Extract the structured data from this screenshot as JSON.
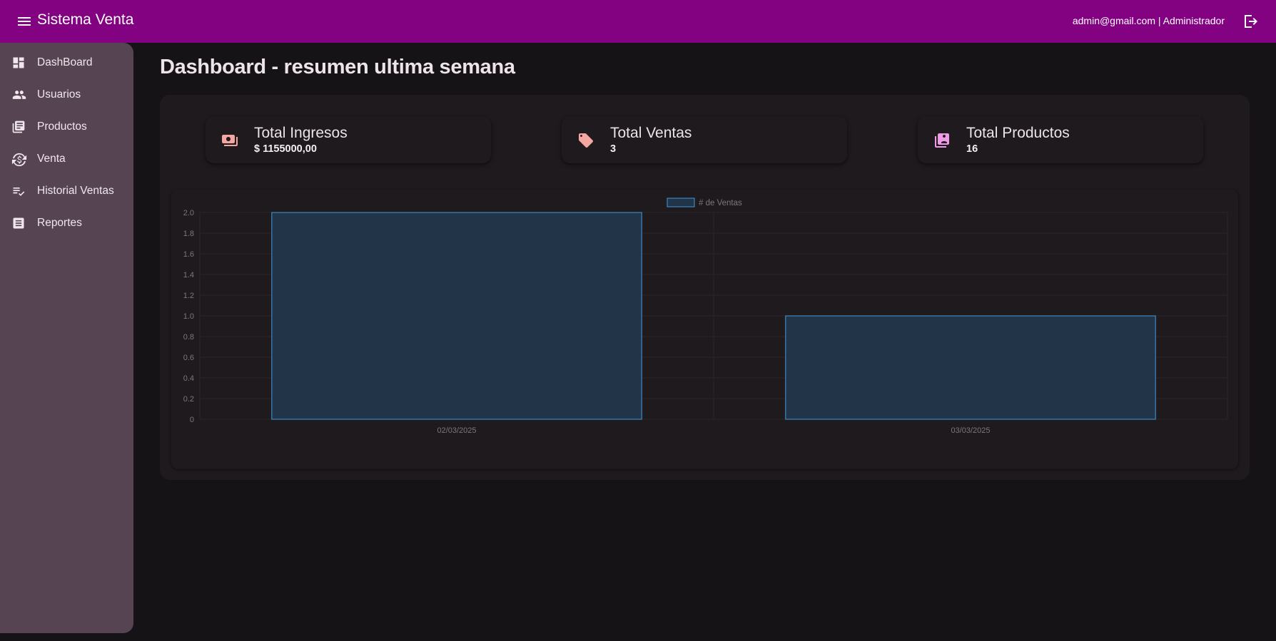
{
  "header": {
    "app_title": "Sistema Venta",
    "user_info": "admin@gmail.com | Administrador",
    "menu_icon": "menu-icon",
    "logout_icon": "logout-icon"
  },
  "sidebar": {
    "items": [
      {
        "label": "DashBoard",
        "icon": "dashboard-icon"
      },
      {
        "label": "Usuarios",
        "icon": "users-icon"
      },
      {
        "label": "Productos",
        "icon": "products-icon"
      },
      {
        "label": "Venta",
        "icon": "sale-icon"
      },
      {
        "label": "Historial Ventas",
        "icon": "history-icon"
      },
      {
        "label": "Reportes",
        "icon": "reports-icon"
      }
    ]
  },
  "main": {
    "title": "Dashboard - resumen ultima semana",
    "cards": [
      {
        "title": "Total Ingresos",
        "value": "$ 1155000,00",
        "icon": "money-icon"
      },
      {
        "title": "Total Ventas",
        "value": "3",
        "icon": "tag-icon"
      },
      {
        "title": "Total Productos",
        "value": "16",
        "icon": "collection-icon"
      }
    ]
  },
  "colors": {
    "header_bg": "#820282",
    "sidebar_bg": "#564452",
    "page_bg": "#161316",
    "panel_bg": "#1e1a1e",
    "icon_accent": "#f4a6a0",
    "bar_fill": "#223447",
    "bar_stroke": "#3d88c4"
  },
  "chart_data": {
    "type": "bar",
    "categories": [
      "02/03/2025",
      "03/03/2025"
    ],
    "series": [
      {
        "name": "# de Ventas",
        "values": [
          2,
          1
        ]
      }
    ],
    "ylim": [
      0,
      2
    ],
    "yticks": [
      "0",
      "0.2",
      "0.4",
      "0.6",
      "0.8",
      "1.0",
      "1.2",
      "1.4",
      "1.6",
      "1.8",
      "2.0"
    ],
    "legend": "top-center",
    "grid": true
  }
}
